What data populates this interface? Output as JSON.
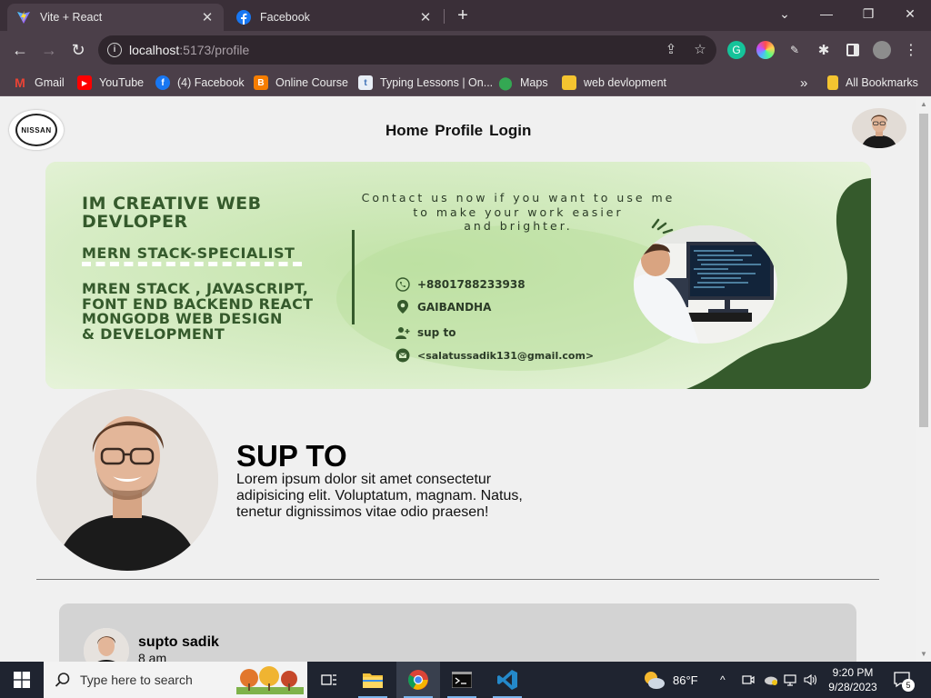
{
  "browser": {
    "tabs": [
      {
        "title": "Vite + React",
        "active": true
      },
      {
        "title": "Facebook",
        "active": false
      }
    ],
    "new_tab": "+",
    "window_controls": {
      "minimize": "—",
      "restore": "❐",
      "close": "✕"
    },
    "url": {
      "host": "localhost",
      "rest": ":5173/profile"
    },
    "bookmarks": [
      {
        "label": "Gmail",
        "icon": "gmail-icon",
        "color": "#ea4335"
      },
      {
        "label": "YouTube",
        "icon": "youtube-icon",
        "color": "#ff0000"
      },
      {
        "label": "(4) Facebook",
        "icon": "facebook-icon",
        "color": "#1877f2"
      },
      {
        "label": "Online Course",
        "icon": "blogger-icon",
        "color": "#f57d00"
      },
      {
        "label": "Typing Lessons | On...",
        "icon": "typing-icon",
        "color": "#5b8fd6"
      },
      {
        "label": "Maps",
        "icon": "maps-icon",
        "color": "#34a853"
      },
      {
        "label": "web devlopment",
        "icon": "folder-icon",
        "color": "#f4c430"
      }
    ],
    "bookmarks_overflow": "»",
    "all_bookmarks": "All Bookmarks"
  },
  "site": {
    "logo_text": "NISSAN",
    "nav": [
      "Home",
      "Profile",
      "Login"
    ],
    "banner": {
      "headline_1": "IM CREATIVE WEB",
      "headline_2": "DEVLOPER",
      "specialist": "MERN STACK-SPECIALIST",
      "skills": [
        "MREN STACK , JAVASCRIPT,",
        "FONT END BACKEND REACT",
        "MONGODB WEB DESIGN",
        "& DEVELOPMENT"
      ],
      "contact_lines": [
        "Contact us now if you want to use me",
        "to make your work easier",
        "and brighter."
      ],
      "phone": "+8801788233938",
      "location": "GAIBANDHA",
      "name": "sup to",
      "email": "<salatussadik131@gmail.com>",
      "colors": {
        "bg": "#d8ecc7",
        "dark_green": "#355a2c"
      }
    },
    "profile": {
      "name": "SUP TO",
      "bio": "Lorem ipsum dolor sit amet consectetur adipisicing elit. Voluptatum, magnam. Natus, tenetur dignissimos vitae odio praesen!"
    },
    "post": {
      "user": "supto sadik",
      "time": "8 am"
    }
  },
  "taskbar": {
    "search_placeholder": "Type here to search",
    "weather": "86°F",
    "time": "9:20 PM",
    "date": "9/28/2023",
    "notifications": "5"
  }
}
